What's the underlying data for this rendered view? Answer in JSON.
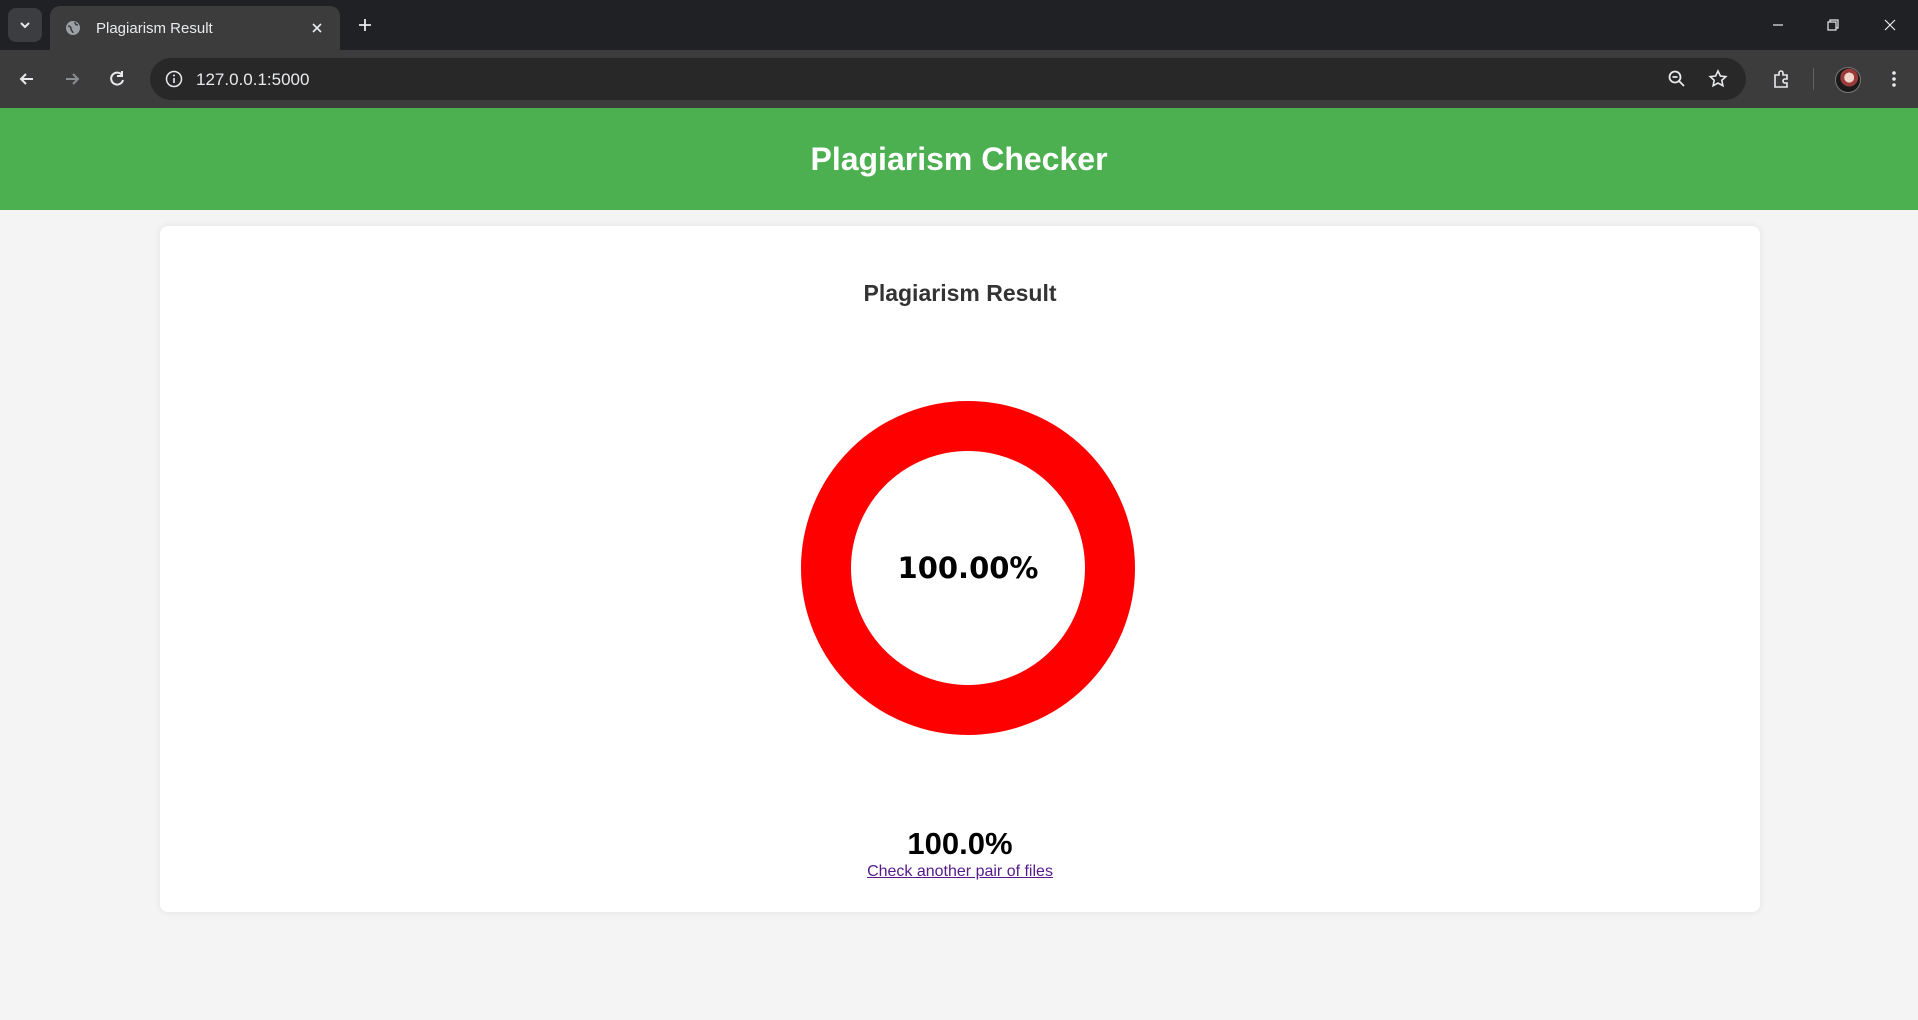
{
  "browser": {
    "tab_title": "Plagiarism Result",
    "url": "127.0.0.1:5000"
  },
  "header": {
    "title": "Plagiarism Checker"
  },
  "result": {
    "heading": "Plagiarism Result",
    "percentage": 100,
    "donut_label": "100.00%",
    "score_text": "100.0%",
    "link_text": "Check another pair of files",
    "ring_color": "#ff0000",
    "header_color": "#4caf50"
  }
}
